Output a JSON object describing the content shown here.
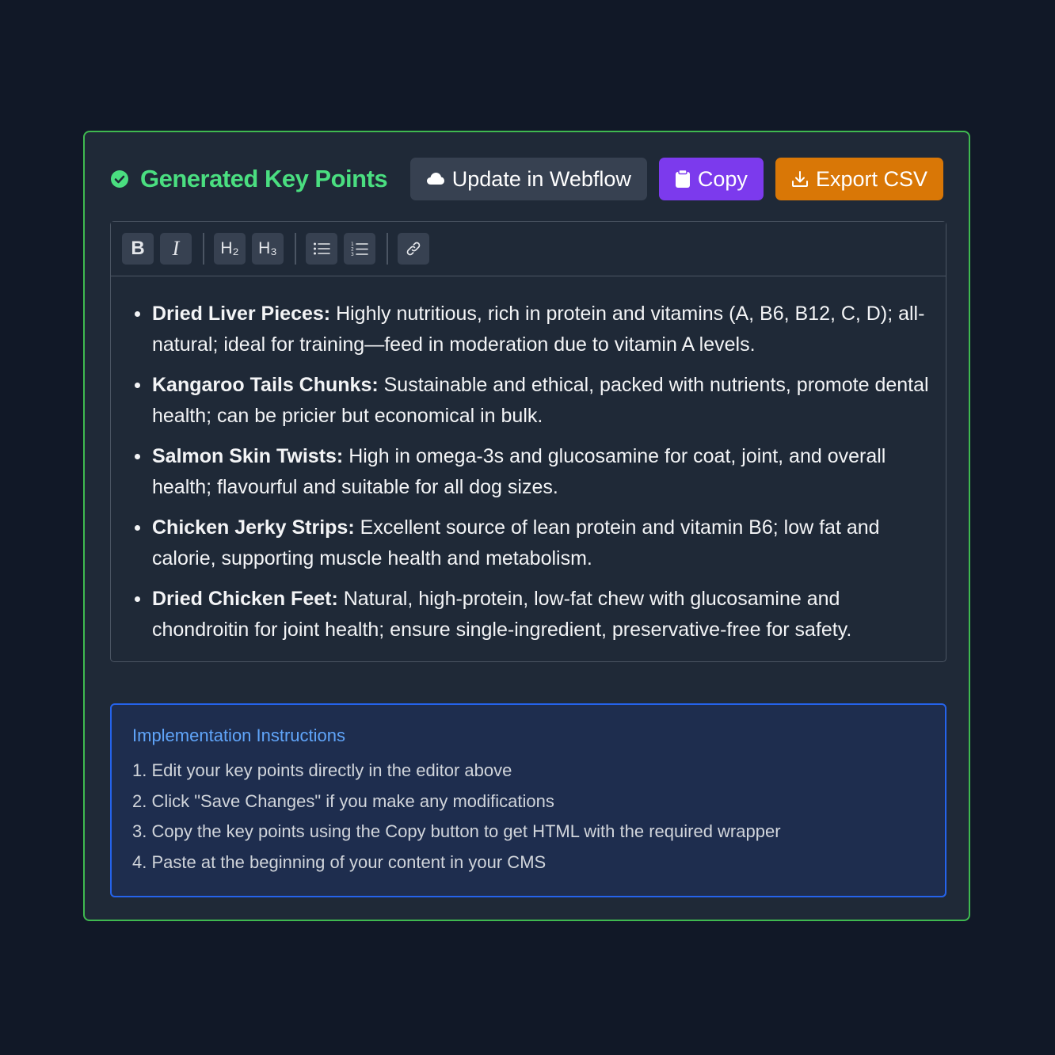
{
  "header": {
    "title": "Generated Key Points",
    "buttons": {
      "webflow": "Update in Webflow",
      "copy": "Copy",
      "export": "Export CSV"
    }
  },
  "toolbar": {
    "bold": "B",
    "italic": "I",
    "h2": "H₂",
    "h3": "H₃"
  },
  "key_points": [
    {
      "label": "Dried Liver Pieces:",
      "text": " Highly nutritious, rich in protein and vitamins (A, B6, B12, C, D); all-natural; ideal for training—feed in moderation due to vitamin A levels."
    },
    {
      "label": "Kangaroo Tails Chunks:",
      "text": " Sustainable and ethical, packed with nutrients, promote dental health; can be pricier but economical in bulk."
    },
    {
      "label": "Salmon Skin Twists:",
      "text": " High in omega-3s and glucosamine for coat, joint, and overall health; flavourful and suitable for all dog sizes."
    },
    {
      "label": "Chicken Jerky Strips:",
      "text": " Excellent source of lean protein and vitamin B6; low fat and calorie, supporting muscle health and metabolism."
    },
    {
      "label": "Dried Chicken Feet:",
      "text": " Natural, high-protein, low-fat chew with glucosamine and chondroitin for joint health; ensure single-ingredient, preservative-free for safety."
    }
  ],
  "instructions": {
    "title": "Implementation Instructions",
    "items": [
      "1. Edit your key points directly in the editor above",
      "2. Click \"Save Changes\" if you make any modifications",
      "3. Copy the key points using the Copy button to get HTML with the required wrapper",
      "4. Paste at the beginning of your content in your CMS"
    ]
  },
  "colors": {
    "page_bg": "#111827",
    "card_border": "#3fb950",
    "title": "#4ade80",
    "copy_button": "#7c3aed",
    "export_button": "#d97706",
    "instructions_border": "#2563eb",
    "instructions_title": "#60a5fa"
  },
  "icons": {
    "title": "check-circle-icon",
    "webflow": "cloud-icon",
    "copy": "clipboard-icon",
    "export": "download-icon",
    "bullet_list": "bullet-list-icon",
    "numbered_list": "numbered-list-icon",
    "link": "link-icon"
  }
}
